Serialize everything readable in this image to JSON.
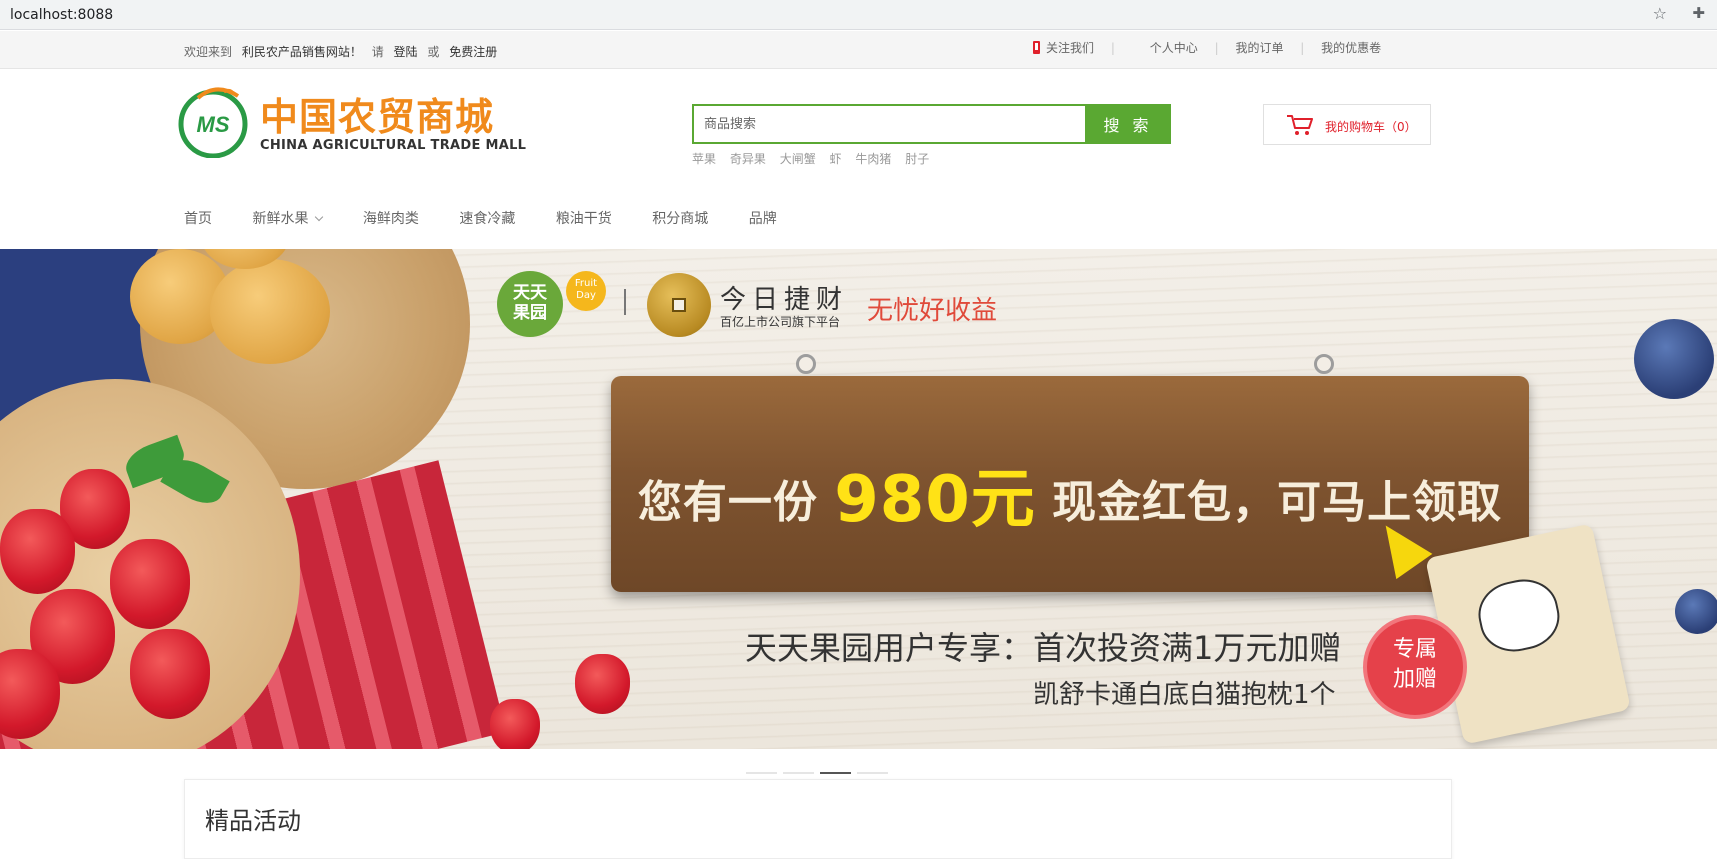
{
  "browser": {
    "url": "localhost:8088",
    "star_icon": "star-icon",
    "ext_icon": "puzzle-icon"
  },
  "topbar": {
    "welcome": "欢迎来到",
    "site_name": "利民农产品销售网站！",
    "please": "请",
    "login": "登陆",
    "or": "或",
    "register": "免费注册",
    "follow": "关注我们",
    "personal": "个人中心",
    "orders": "我的订单",
    "coupons": "我的优惠卷"
  },
  "logo": {
    "cn": "中国农贸商城",
    "en": "CHINA AGRICULTURAL TRADE MALL",
    "mark": "MS"
  },
  "search": {
    "placeholder": "商品搜索",
    "button": "搜 索",
    "hot_words": [
      "苹果",
      "奇异果",
      "大闸蟹",
      "虾",
      "牛肉猪",
      "肘子"
    ]
  },
  "cart": {
    "label": "我的购物车（0）"
  },
  "nav": {
    "items": [
      "首页",
      "新鲜水果",
      "海鲜肉类",
      "速食冷藏",
      "粮油干货",
      "积分商城",
      "品牌"
    ]
  },
  "banner": {
    "brand1": "天天果园",
    "brand1_badge": "Fruit Day",
    "brand2_title": "今日捷财",
    "brand2_sub": "百亿上市公司旗下平台",
    "slogan": "无忧好收益",
    "headline_pre": "您有一份",
    "headline_amount": "980元",
    "headline_post": "现金红包，可马上领取",
    "promo_line1": "天天果园用户专享：首次投资满1万元加赠",
    "promo_line2": "凯舒卡通白底白猫抱枕1个",
    "stamp": "专属加赠"
  },
  "carousel": {
    "count": 4,
    "active_index": 2
  },
  "section": {
    "title": "精品活动"
  },
  "colors": {
    "brand_green": "#5aa832",
    "logo_orange": "#f08a1c",
    "cart_red": "#e0202b"
  }
}
